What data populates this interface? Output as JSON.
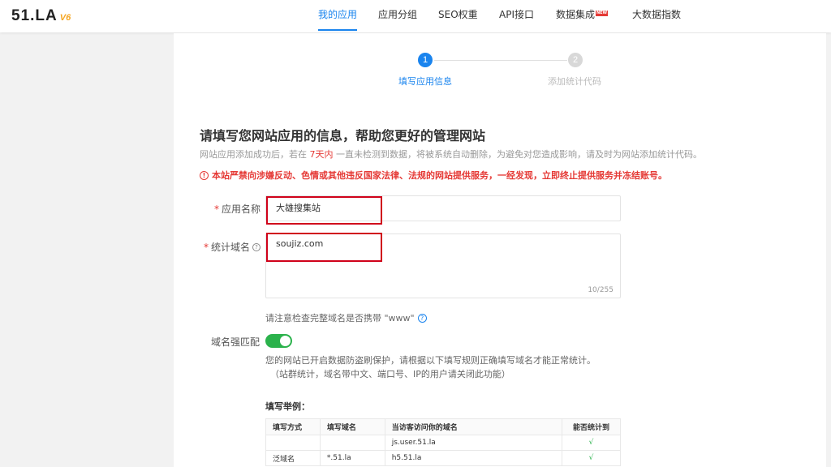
{
  "logo": {
    "main": "51.LA",
    "version": "V6"
  },
  "nav": {
    "items": [
      {
        "label": "我的应用",
        "active": true
      },
      {
        "label": "应用分组"
      },
      {
        "label": "SEO权重"
      },
      {
        "label": "API接口"
      },
      {
        "label": "数据集成",
        "badge": "NEW"
      },
      {
        "label": "大数据指数"
      }
    ]
  },
  "steps": [
    {
      "number": "1",
      "label": "填写应用信息",
      "active": true
    },
    {
      "number": "2",
      "label": "添加统计代码",
      "active": false
    }
  ],
  "page": {
    "title": "请填写您网站应用的信息，帮助您更好的管理网站",
    "desc_prefix": "网站应用添加成功后，若在 ",
    "desc_highlight": "7天内",
    "desc_suffix": " 一直未检测到数据，将被系统自动删除，为避免对您造成影响，请及时为网站添加统计代码。",
    "warning": "本站严禁向涉嫌反动、色情或其他违反国家法律、法规的网站提供服务，一经发现，立即终止提供服务并冻结账号。",
    "warning_icon": "!"
  },
  "form": {
    "required_mark": "*",
    "app_name_label": "应用名称",
    "app_name_value": "大雄搜集站",
    "domain_label": "统计域名",
    "domain_value": "soujiz.com",
    "domain_counter": "10/255",
    "help_glyph": "?",
    "domain_hint": "请注意检查完整域名是否携带 \"www\"",
    "strict_match_label": "域名强匹配",
    "strict_match_on": true,
    "strict_info_1": "您的网站已开启数据防盗刷保护，请根据以下填写规则正确填写域名才能正常统计。",
    "strict_info_2": "（站群统计，域名带中文、端口号、IP的用户请关闭此功能）"
  },
  "example": {
    "title": "填写举例：",
    "headers": [
      "填写方式",
      "填写域名",
      "当访客访问你的域名",
      "能否统计到"
    ],
    "rows": [
      {
        "mode": "",
        "domain": "",
        "visit": "js.user.51.la",
        "ok": "√"
      },
      {
        "mode": "泛域名",
        "domain": "*.51.la",
        "visit": "h5.51.la",
        "ok": "√"
      }
    ]
  },
  "colors": {
    "accent": "#1a84ee",
    "danger": "#e53935",
    "toggle_on": "#2bb24c",
    "highlight_box": "#d0021b"
  }
}
